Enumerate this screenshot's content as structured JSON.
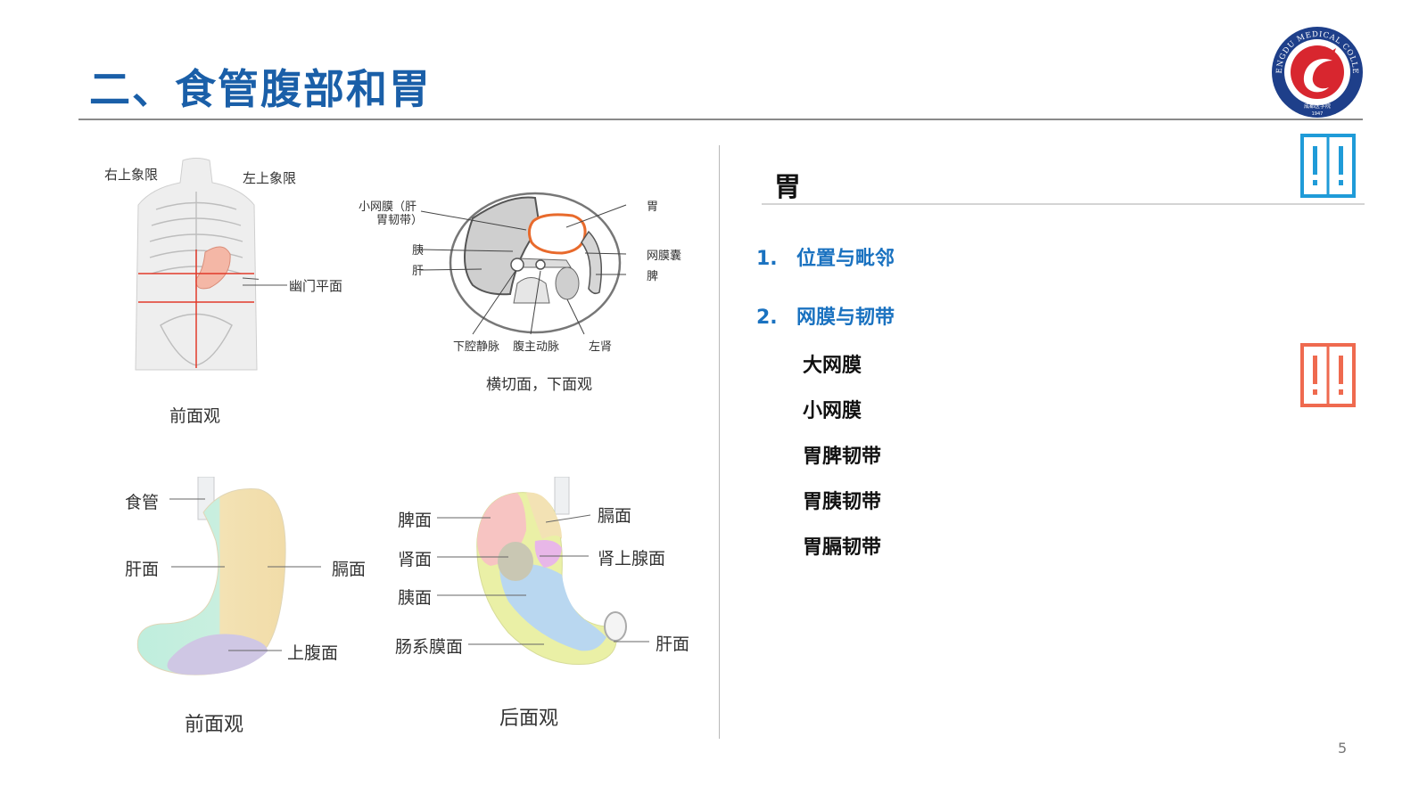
{
  "slide": {
    "title": "二、食管腹部和胃",
    "page_number": "5"
  },
  "logo": {
    "ring_text": "CHENGDU MEDICAL COLLEGE",
    "year": "1947",
    "chinese_name": "成都医学院",
    "colors": {
      "ring": "#1e3f8a",
      "center": "#d8262f"
    }
  },
  "figures": {
    "torso": {
      "labels": {
        "upper_right_quadrant": "右上象限",
        "upper_left_quadrant": "左上象限",
        "pyloric_plane": "幽门平面"
      },
      "caption": "前面观"
    },
    "cross_section": {
      "labels": {
        "lesser_omentum_line1": "小网膜（肝",
        "lesser_omentum_line2": "胃韧带）",
        "pancreas": "胰",
        "liver": "肝",
        "stomach": "胃",
        "omental_bursa": "网膜囊",
        "spleen": "脾",
        "ivc": "下腔静脉",
        "aorta": "腹主动脉",
        "left_kidney": "左肾"
      },
      "caption": "横切面，下面观"
    },
    "stomach_front": {
      "labels": {
        "esophagus": "食管",
        "hepatic_surface": "肝面",
        "diaphragmatic_surface": "膈面",
        "epigastric_surface": "上腹面"
      },
      "caption": "前面观"
    },
    "stomach_back": {
      "labels": {
        "splenic_surface": "脾面",
        "diaphragmatic_surface": "膈面",
        "renal_surface": "肾面",
        "suprarenal_surface": "肾上腺面",
        "pancreatic_surface": "胰面",
        "mesocolic_surface": "肠系膜面",
        "hepatic_surface": "肝面"
      },
      "caption": "后面观"
    }
  },
  "content": {
    "section_title": "胃",
    "numbered": [
      {
        "num": "1.",
        "label": "位置与毗邻"
      },
      {
        "num": "2.",
        "label": "网膜与韧带"
      }
    ],
    "sub_items": [
      "大网膜",
      "小网膜",
      "胃脾韧带",
      "胃胰韧带",
      "胃膈韧带"
    ]
  },
  "colors": {
    "title_blue": "#1a5fa8",
    "item_blue": "#1a72c0",
    "icon_blue": "#1f9bd8",
    "icon_red": "#ef6a4f"
  }
}
